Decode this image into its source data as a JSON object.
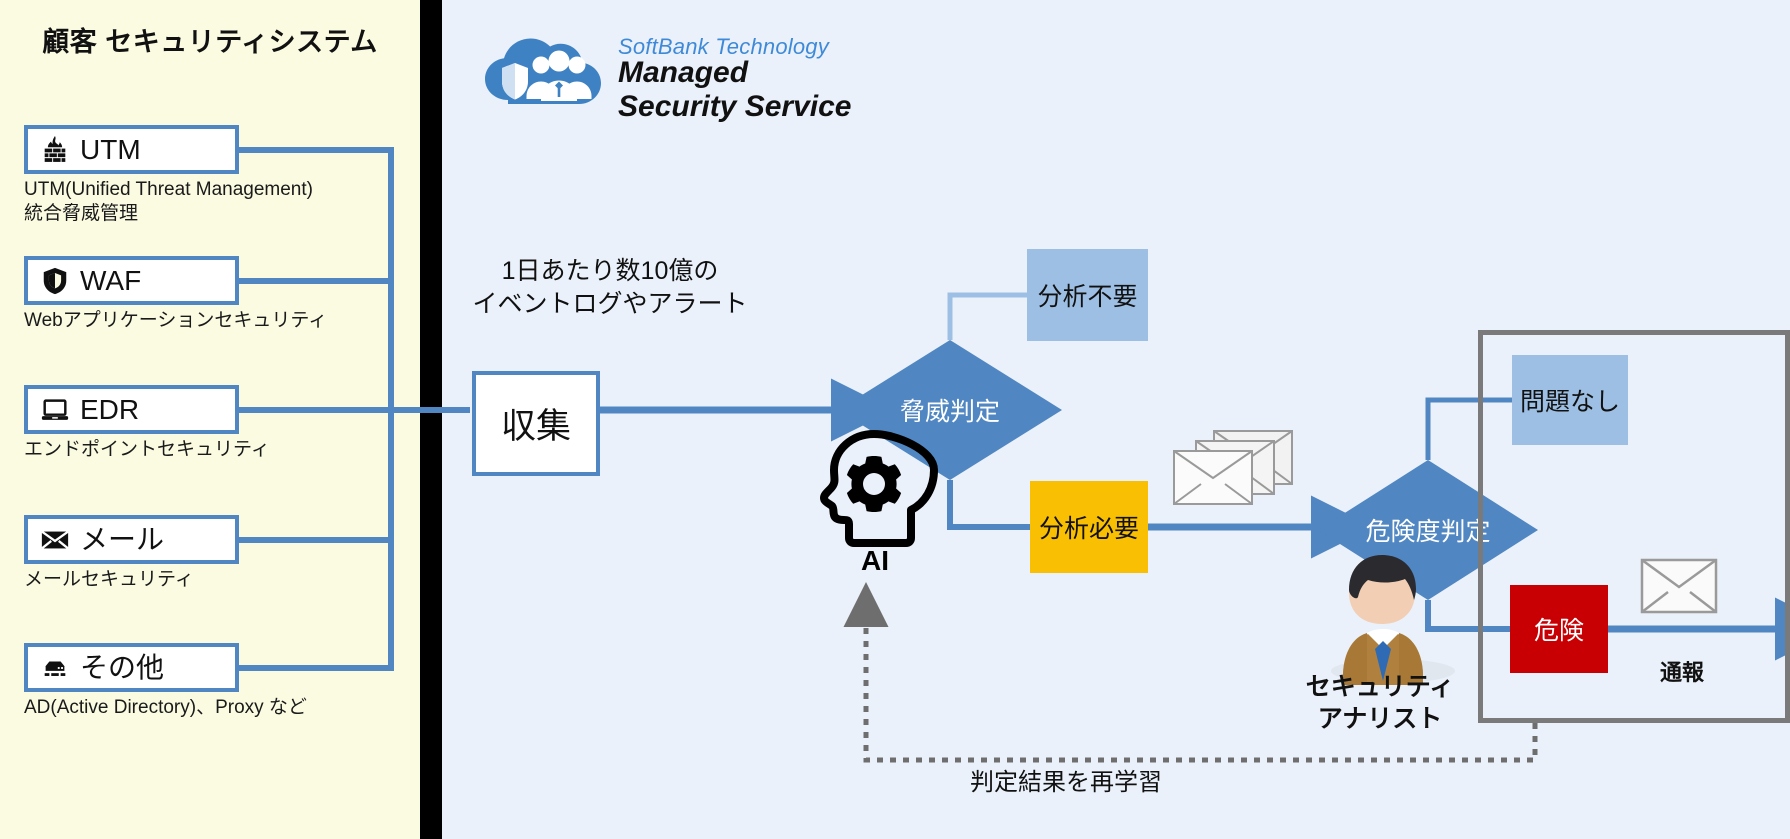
{
  "left_panel": {
    "title": "顧客\nセキュリティシステム",
    "bg_color": "#fbfbe2",
    "items": [
      {
        "icon": "firewall-icon",
        "label": "UTM",
        "desc": "UTM(Unified Threat Management)\n統合脅威管理"
      },
      {
        "icon": "shield-icon",
        "label": "WAF",
        "desc": "Webアプリケーションセキュリティ"
      },
      {
        "icon": "laptop-icon",
        "label": "EDR",
        "desc": "エンドポイントセキュリティ"
      },
      {
        "icon": "envelope-icon",
        "label": "メール",
        "desc": "メールセキュリティ"
      },
      {
        "icon": "server-icon",
        "label": "その他",
        "desc": "AD(Active Directory)、Proxy など"
      }
    ]
  },
  "logo": {
    "brand": "SoftBank Technology",
    "product": "Managed\nSecurity Service",
    "brand_color": "#3f8ad8",
    "icon": "cloud-shield-people-icon"
  },
  "flow": {
    "volume_note": "1日あたり数10億の\nイベントログやアラート",
    "collect": "収集",
    "threat_decision": "脅威判定",
    "no_analysis_needed": "分析不要",
    "analysis_needed": "分析必要",
    "risk_decision": "危険度判定",
    "no_problem": "問題なし",
    "danger": "危険",
    "report": "通報",
    "relearn": "判定結果を再学習",
    "ai_label": "AI",
    "analyst_label": "セキュリティ\nアナリスト"
  },
  "colors": {
    "accent_blue": "#5086c1",
    "light_blue_box": "#9dbfe4",
    "amber": "#f9bf02",
    "danger_red": "#c80003",
    "right_bg": "#eaf1fa",
    "frame_gray": "#7a7a7a"
  },
  "icons": {
    "mail_stack": "envelope-stack-icon",
    "mail_single": "envelope-icon",
    "ai_head": "ai-head-gear-icon",
    "analyst": "analyst-avatar-icon"
  }
}
